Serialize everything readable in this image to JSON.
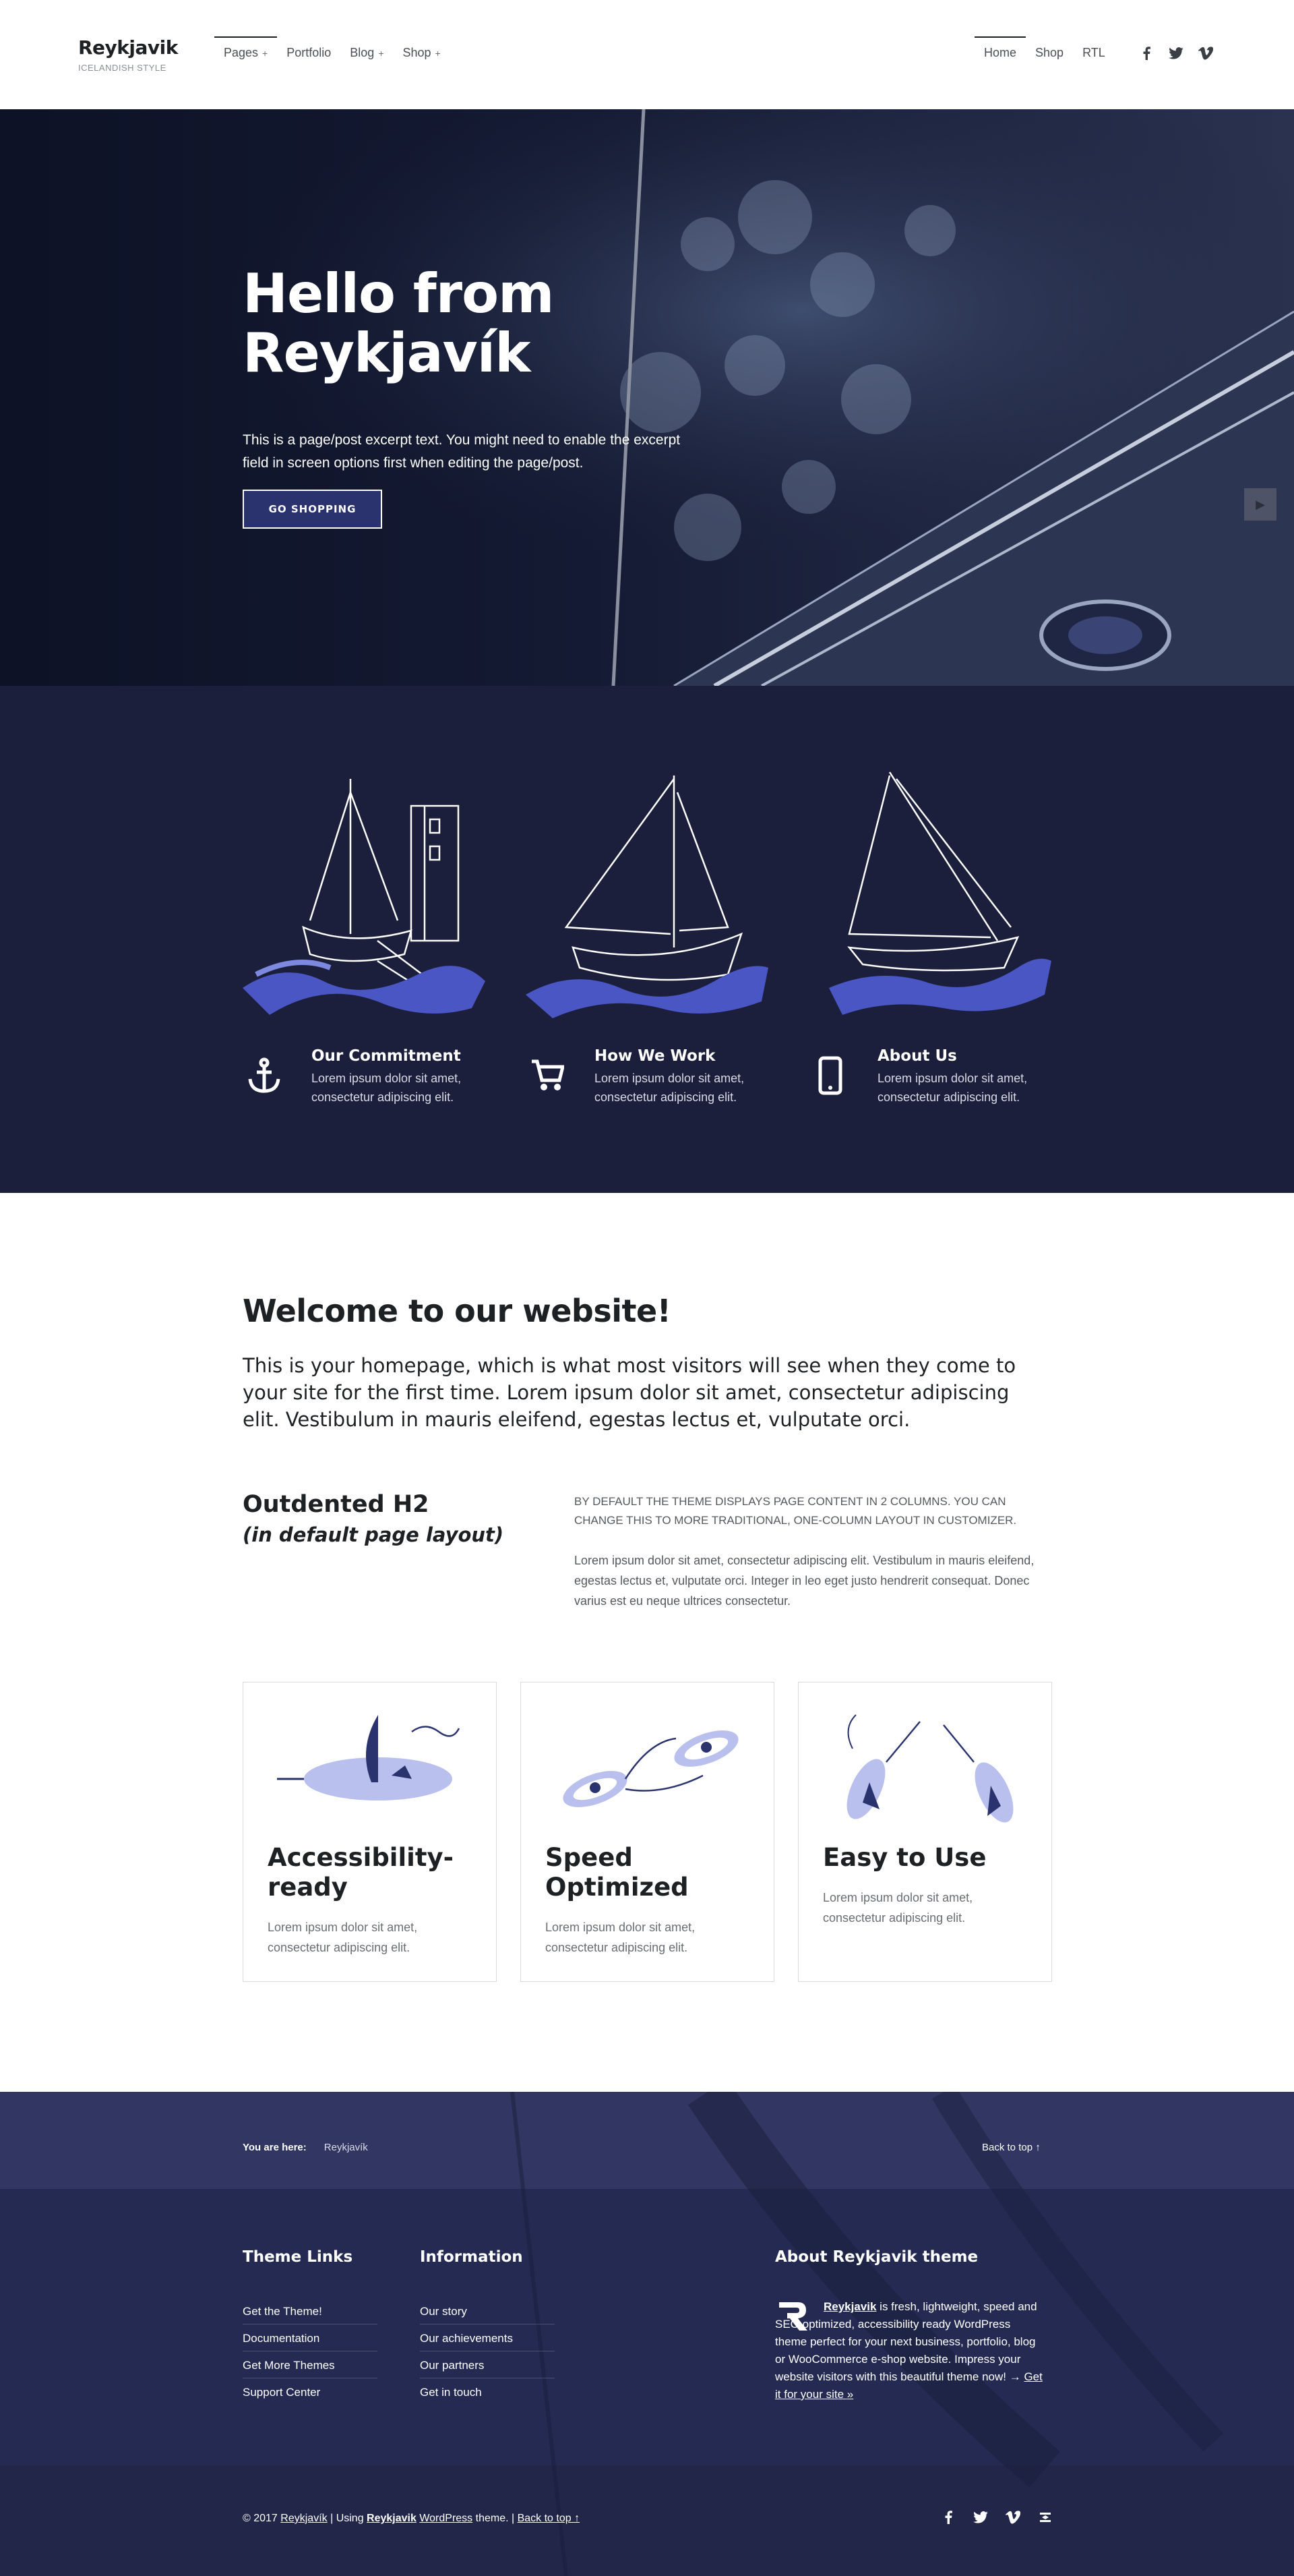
{
  "site": {
    "name": "Reykjavik",
    "tagline": "ICELANDISH STYLE"
  },
  "nav_left": [
    {
      "label": "Pages",
      "plus": "+",
      "active": true
    },
    {
      "label": "Portfolio",
      "plus": ""
    },
    {
      "label": "Blog",
      "plus": "+"
    },
    {
      "label": "Shop",
      "plus": "+"
    }
  ],
  "nav_right": [
    {
      "label": "Home",
      "active": true
    },
    {
      "label": "Shop"
    },
    {
      "label": "RTL"
    }
  ],
  "social_icons": [
    "facebook-icon",
    "twitter-icon",
    "vimeo-icon"
  ],
  "hero": {
    "title_line1": "Hello from",
    "title_line2": "Reykjavík",
    "excerpt": "This is a page/post excerpt text. You might need to enable the excerpt field in screen options first when editing the page/post.",
    "button": "GO SHOPPING",
    "next_arrow": "▶"
  },
  "features": [
    {
      "icon": "anchor-icon",
      "title": "Our Commitment",
      "text": "Lorem ipsum dolor sit amet, consectetur adipiscing elit."
    },
    {
      "icon": "cart-icon",
      "title": "How We Work",
      "text": "Lorem ipsum dolor sit amet, consectetur adipiscing elit."
    },
    {
      "icon": "phone-icon",
      "title": "About Us",
      "text": "Lorem ipsum dolor sit amet, consectetur adipiscing elit."
    }
  ],
  "welcome": {
    "heading": "Welcome to our website!",
    "intro": "This is your homepage, which is what most visitors will see when they come to your site for the first time. Lorem ipsum dolor sit amet, consectetur adipiscing elit. Vestibulum in mauris eleifend, egestas lectus et, vulputate orci."
  },
  "outdented": {
    "h2": "Outdented H2",
    "sub": "(in default page layout)",
    "caps": "By default the theme displays page content in 2 columns. You can change this to more traditional, one-column layout in Customizer.",
    "para": "Lorem ipsum dolor sit amet, consectetur adipiscing elit. Vestibulum in mauris eleifend, egestas lectus et, vulputate orci. Integer in leo eget justo hendrerit consequat. Donec varius est eu neque ultrices consectetur."
  },
  "cards": [
    {
      "title": "Accessibility-ready",
      "text": "Lorem ipsum dolor sit amet, consectetur adipiscing elit."
    },
    {
      "title": "Speed Optimized",
      "text": "Lorem ipsum dolor sit amet, consectetur adipiscing elit."
    },
    {
      "title": "Easy to Use",
      "text": "Lorem ipsum dolor sit amet, consectetur adipiscing elit."
    }
  ],
  "breadcrumb": {
    "label": "You are here:",
    "value": "Reykjavík",
    "back_to_top": "Back to top ↑"
  },
  "footer": {
    "theme_links": {
      "title": "Theme Links",
      "items": [
        "Get the Theme!",
        "Documentation",
        "Get More Themes",
        "Support Center"
      ]
    },
    "information": {
      "title": "Information",
      "items": [
        "Our story",
        "Our achievements",
        "Our partners",
        "Get in touch"
      ]
    },
    "about": {
      "title": "About Reykjavik theme",
      "link": "Reykjavik",
      "text": " is fresh, lightweight, speed and SEO optimized, accessibility ready WordPress theme perfect for your next business, portfolio, blog or WooCommerce e-shop website. Impress your website visitors with this beautiful theme now! → ",
      "cta": "Get it for your site »"
    },
    "copyright": {
      "prefix": "© 2017 ",
      "site": "Reykjavík",
      "using": " | Using ",
      "theme": "Reykjavik",
      "wp": "WordPress",
      "theme_word": " theme. | ",
      "back": "Back to top ↑"
    },
    "social_icons": [
      "facebook-icon",
      "twitter-icon",
      "vimeo-icon",
      "menu-icon"
    ]
  },
  "colors": {
    "dark_navy": "#1b1f3b",
    "accent_blue": "#2a336d",
    "wave_blue": "#4a56c4",
    "text_dark": "#1e2124"
  }
}
